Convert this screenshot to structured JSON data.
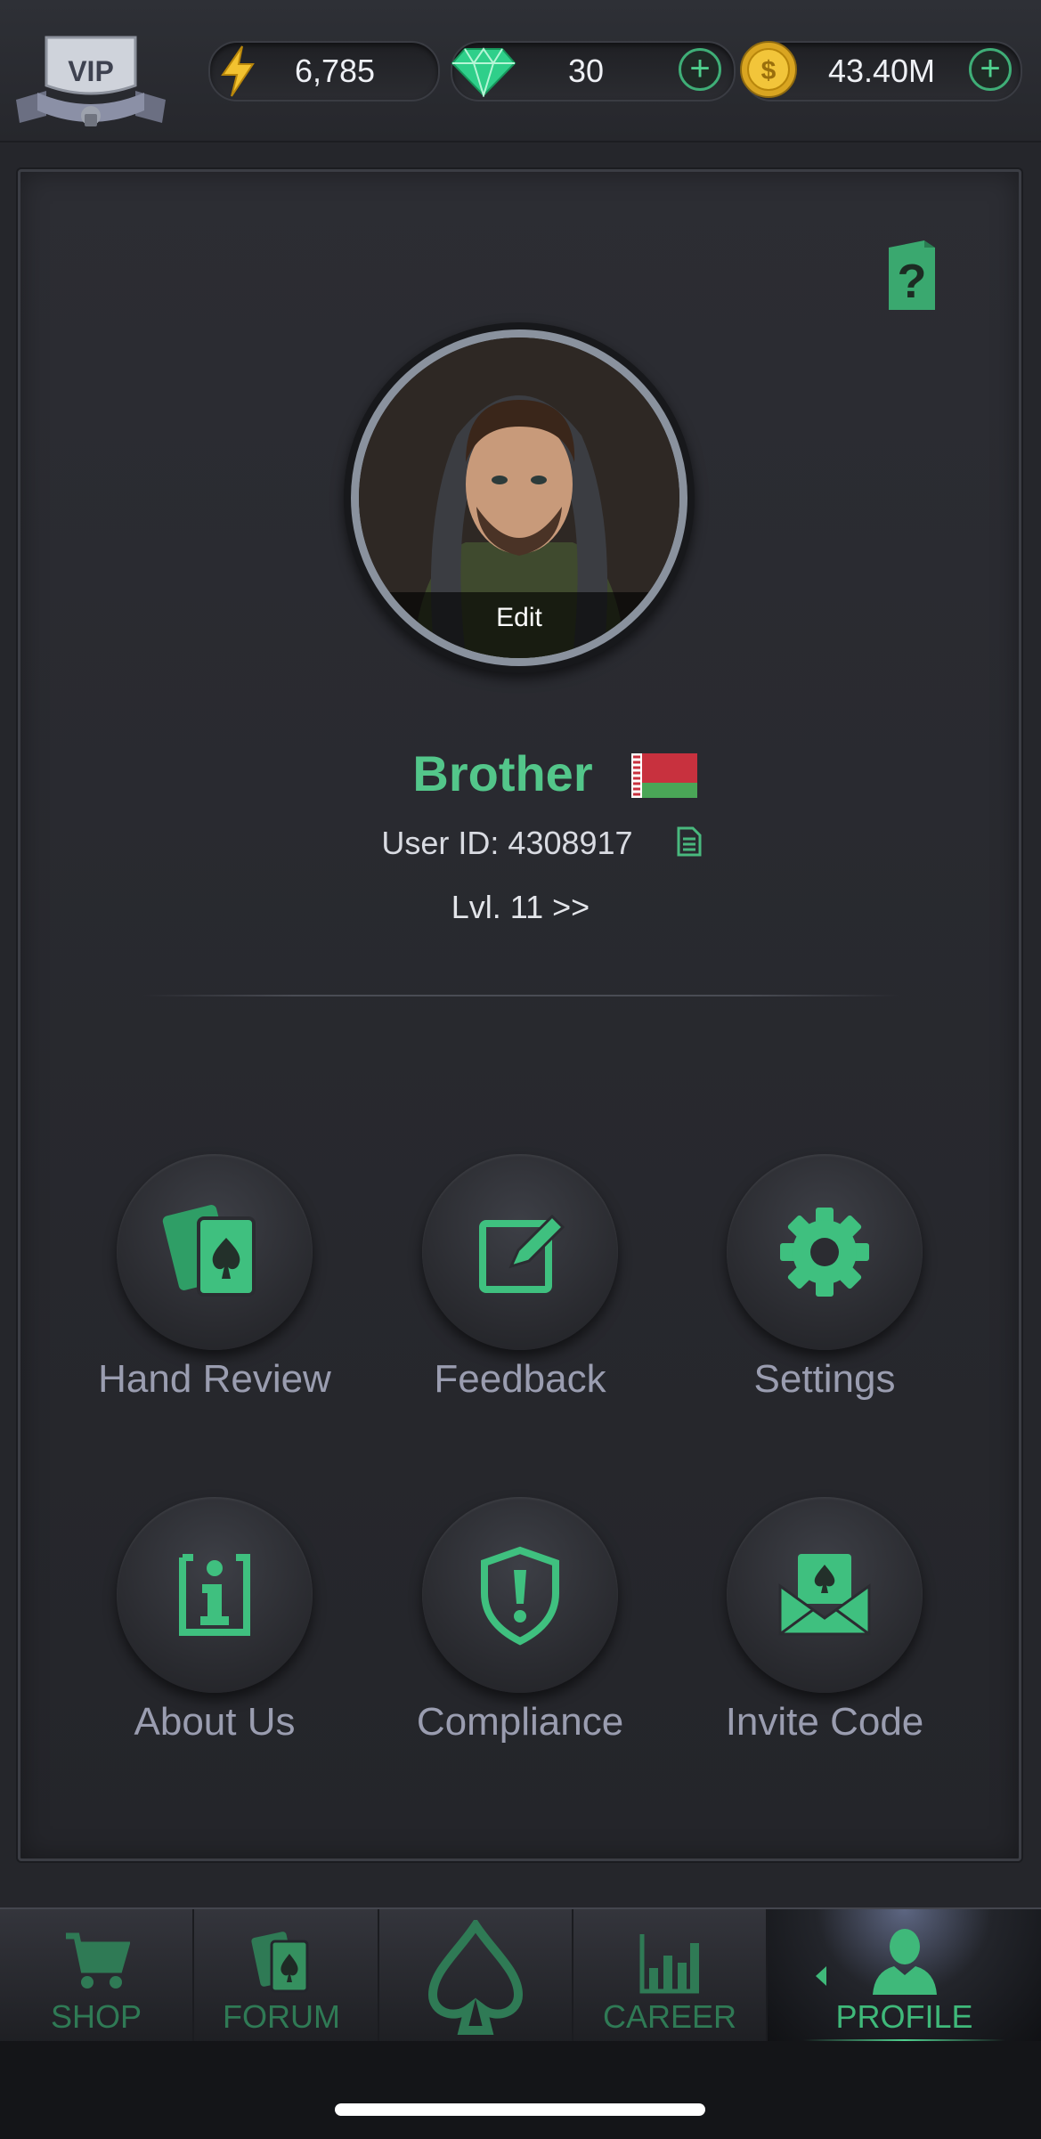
{
  "top_bar": {
    "vip_label": "VIP",
    "energy": {
      "icon": "lightning-icon",
      "value": "6,785"
    },
    "gems": {
      "icon": "gem-icon",
      "value": "30",
      "add_label": "+"
    },
    "coins": {
      "icon": "coin-icon",
      "value": "43.40M",
      "add_label": "+"
    }
  },
  "profile": {
    "edit_label": "Edit",
    "username": "Brother",
    "flag": "belarus-flag-icon",
    "user_id_text": "User ID: 4308917",
    "level_text": "Lvl. 11 >>"
  },
  "menu": [
    {
      "label": "Hand Review",
      "icon": "cards-icon"
    },
    {
      "label": "Feedback",
      "icon": "edit-icon"
    },
    {
      "label": "Settings",
      "icon": "gear-icon"
    },
    {
      "label": "About Us",
      "icon": "info-icon"
    },
    {
      "label": "Compliance",
      "icon": "shield-alert-icon"
    },
    {
      "label": "Invite Code",
      "icon": "envelope-icon"
    }
  ],
  "nav": [
    {
      "label": "SHOP",
      "icon": "cart-icon"
    },
    {
      "label": "FORUM",
      "icon": "cards-icon"
    },
    {
      "label": "",
      "icon": "spade-logo-icon"
    },
    {
      "label": "CAREER",
      "icon": "bar-chart-icon"
    },
    {
      "label": "PROFILE",
      "icon": "person-icon",
      "active": true
    }
  ],
  "colors": {
    "accent_green": "#53c68a",
    "background": "#25262b",
    "label_gray": "#9a9db0"
  }
}
